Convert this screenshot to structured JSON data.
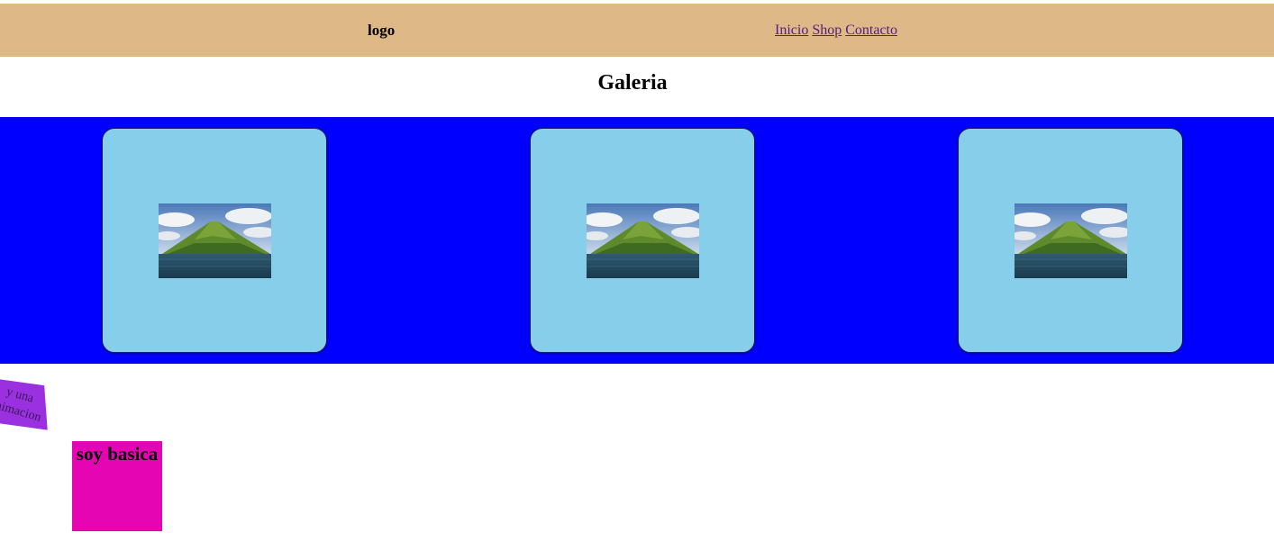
{
  "header": {
    "logo": "logo",
    "nav": [
      {
        "label": "Inicio"
      },
      {
        "label": "Shop"
      },
      {
        "label": "Contacto"
      }
    ]
  },
  "main": {
    "title": "Galeria",
    "gallery": {
      "images": [
        {
          "icon": "mountain-lake-photo"
        },
        {
          "icon": "mountain-lake-photo"
        },
        {
          "icon": "mountain-lake-photo"
        }
      ]
    }
  },
  "animation_box": {
    "line1": "y una",
    "line2": "animacion"
  },
  "basic_box": {
    "text": "soy basica"
  },
  "colors": {
    "header_bg": "#deb887",
    "gallery_bg": "#0000ff",
    "card_bg": "#87ceeb",
    "animation_bg": "#9b30e0",
    "basic_bg": "#e605b3",
    "link": "#551a8b"
  }
}
